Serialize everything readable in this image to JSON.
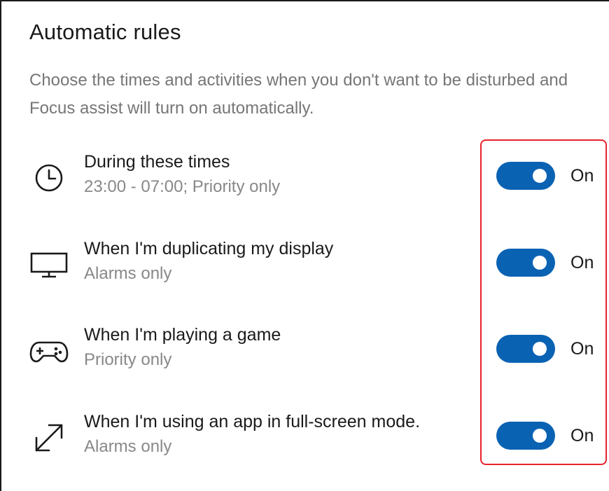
{
  "section": {
    "title": "Automatic rules",
    "description": "Choose the times and activities when you don't want to be disturbed and Focus assist will turn on automatically."
  },
  "rules": [
    {
      "icon": "clock-icon",
      "title": "During these times",
      "subtitle": "23:00 - 07:00; Priority only",
      "state": "On",
      "enabled": true
    },
    {
      "icon": "monitor-icon",
      "title": "When I'm duplicating my display",
      "subtitle": "Alarms only",
      "state": "On",
      "enabled": true
    },
    {
      "icon": "gamepad-icon",
      "title": "When I'm playing a game",
      "subtitle": "Priority only",
      "state": "On",
      "enabled": true
    },
    {
      "icon": "fullscreen-arrow-icon",
      "title": "When I'm using an app in full-screen mode.",
      "subtitle": "Alarms only",
      "state": "On",
      "enabled": true
    }
  ],
  "colors": {
    "toggle_on": "#0a62b3",
    "highlight_border": "#e8232d",
    "secondary_text": "#767676"
  }
}
